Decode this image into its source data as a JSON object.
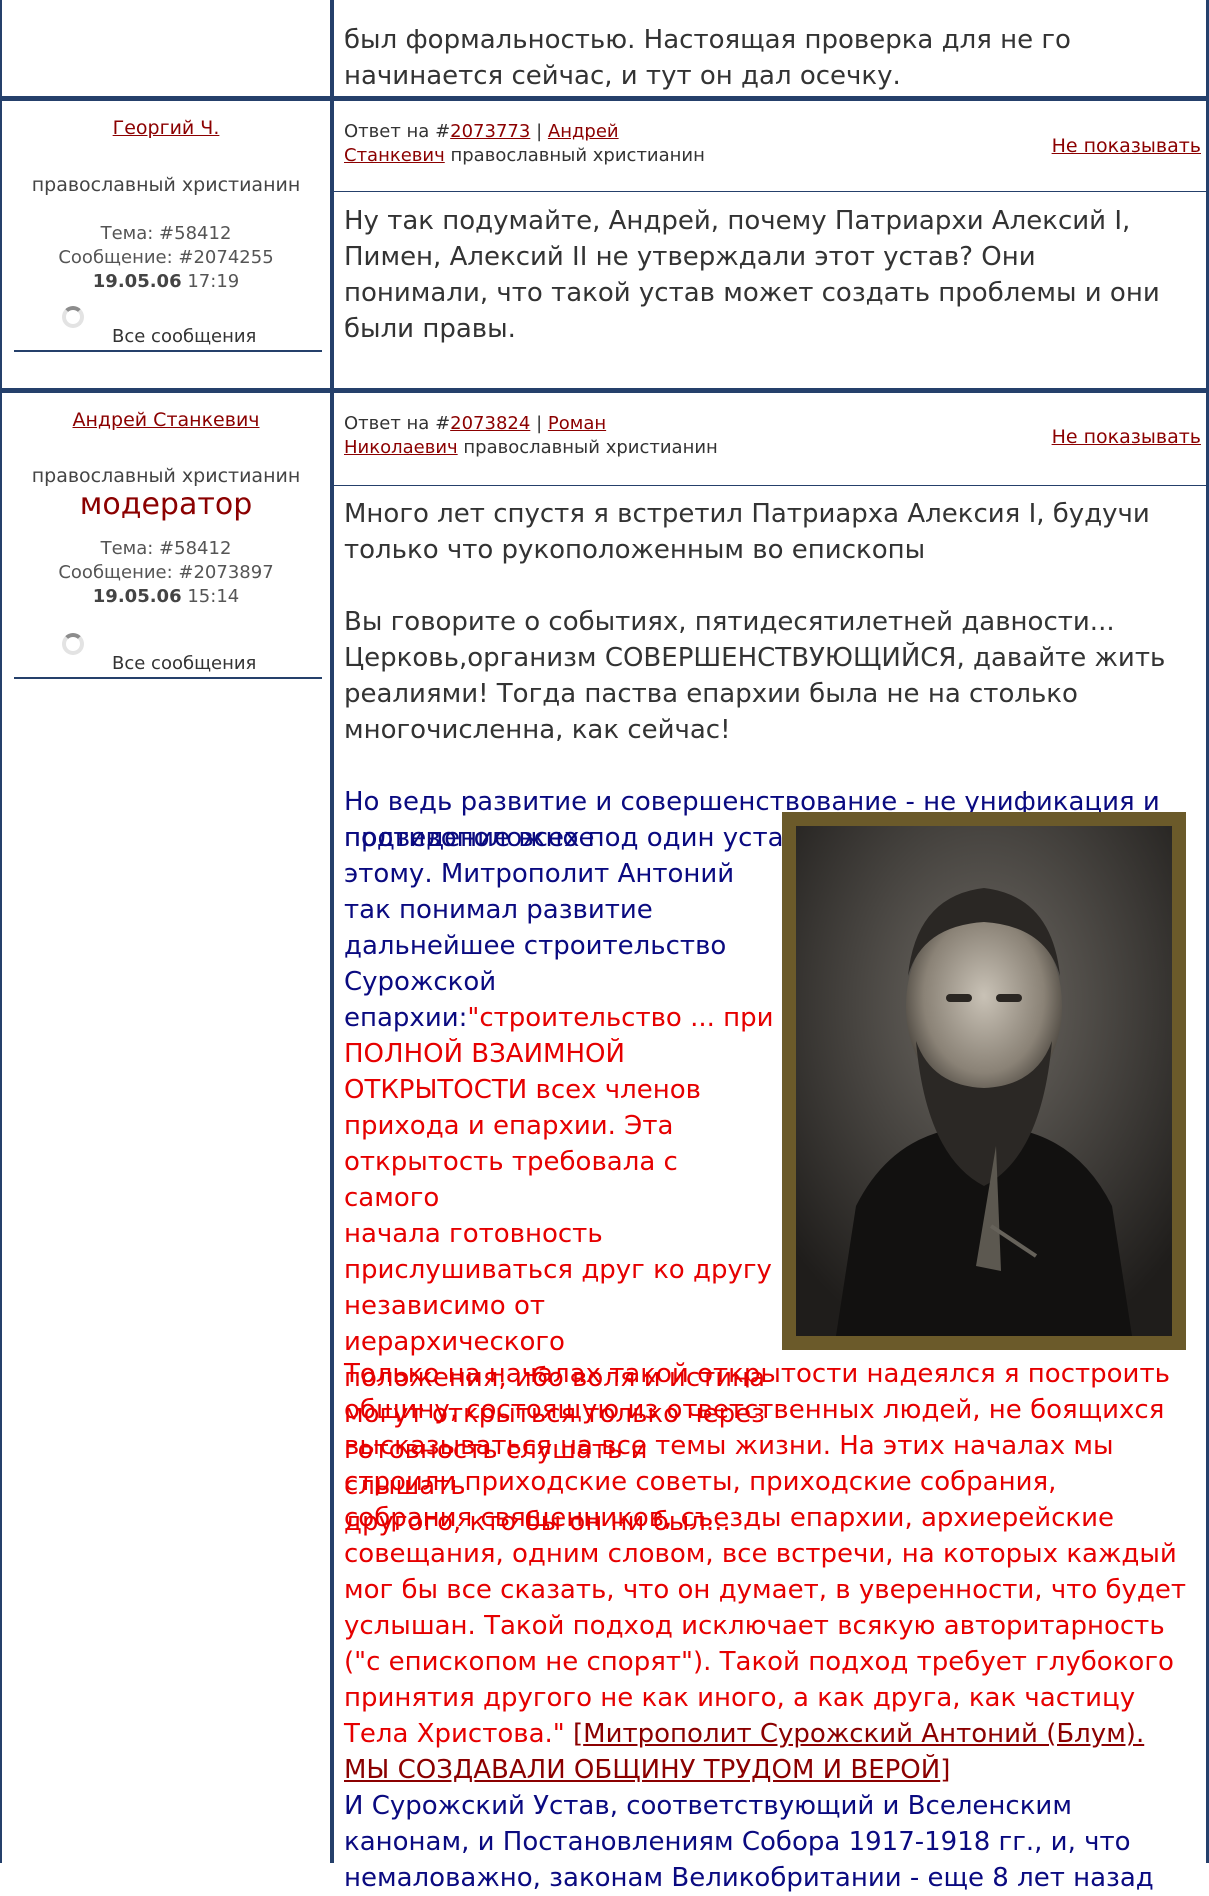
{
  "post0": {
    "text_line1": "был формальностью. Настоящая проверка для не го",
    "text_line2": "начинается сейчас, и тут он дал осечку."
  },
  "post1": {
    "author": "Георгий Ч.",
    "role": "православный христианин",
    "topic": "Тема: #58412",
    "message_id": "Сообщение: #2074255",
    "date": "19.05.06",
    "time": "17:19",
    "all_messages": "Все сообщения",
    "reply_prefix": "Ответ на #",
    "reply_id": "2073773",
    "reply_sep": "|",
    "reply_author_1": "Андрей",
    "reply_author_2": "Станкевич",
    "reply_author_role": "православный христианин",
    "hide": "Не показывать",
    "body": [
      "Ну так подумайте, Андрей, почему Патриархи Алексий I,",
      "Пимен, Алексий II не утверждали этот устав? Они",
      "понимали, что такой устав может создать проблемы и они",
      "были правы."
    ]
  },
  "post2": {
    "author": "Андрей Станкевич",
    "role": "православный христианин",
    "moderator": "модератор",
    "topic": "Тема: #58412",
    "message_id": "Сообщение: #2073897",
    "date": "19.05.06",
    "time": "15:14",
    "all_messages": "Все сообщения",
    "reply_prefix": "Ответ на #",
    "reply_id": "2073824",
    "reply_sep": "|",
    "reply_author_1": "Роман",
    "reply_author_2": "Николаевич",
    "reply_author_role": "православный христианин",
    "hide": "Не показывать",
    "quote_gray": [
      "Много лет спустя я встретил Патриарха Алексия I, будучи",
      "только что рукоположенным во епископы",
      "",
      "Вы говорите о событиях, пятидесятилетней давности...",
      "Церковь,организм СОВЕРШЕНСТВУЮЩИЙСЯ, давайте жить",
      "реалиями! Тогда паства епархии была не на столько",
      "многочисленна, как сейчас!"
    ],
    "blue_full": [
      "Но ведь развитие и совершенствование - не унификация и",
      "подведение всех под один устав - а действие совершенно"
    ],
    "blue_narrow": [
      "противоположное",
      "этому. Митрополит Антоний",
      "так понимал развитие",
      "дальнейшее строительство",
      "Сурожской"
    ],
    "mixed_line_blue": "епархии:",
    "mixed_line_red": "\"строительство ... при",
    "red_narrow": [
      "ПОЛНОЙ ВЗАИМНОЙ",
      "ОТКРЫТОСТИ всех членов",
      "прихода и епархии. Эта",
      "открытость требовала с самого",
      "начала готовность",
      "прислушиваться друг ко другу",
      "независимо от иерархического",
      "положения, ибо воля и истина",
      "могут открыться только через",
      "готовность слушать и слышать",
      "другого, кто бы он ни был..."
    ],
    "red_full": [
      "Только на началах такой открытости надеялся я построить",
      "общину, состоящую из ответственных людей, не боящихся",
      "высказываться на все темы жизни. На этих началах мы",
      "строили приходские советы, приходские собрания,",
      "собрания священников, съезды епархии, архиерейские",
      "совещания, одним словом, все встречи, на которых каждый",
      "мог бы все сказать, что он думает, в уверенности, что будет",
      "услышан. Такой подход исключает всякую авторитарность",
      "(\"с епископом не спорят\"). Такой подход требует глубокого",
      "принятия другого не как иного, а как друга, как частицу"
    ],
    "red_last": "Тела Христова.\"",
    "bracket_open": "[",
    "source_link_1": "Митрополит Сурожский Антоний (Блум).",
    "source_link_2": "МЫ СОЗДАВАЛИ ОБЩИНУ ТРУДОМ И ВЕРОЙ",
    "bracket_close": "]",
    "blue_end": [
      "И Сурожский Устав, соответствующий и Вселенским",
      "канонам, и Постановлениям Собора 1917-1918 гг., и, что",
      "немаловажно, законам Великобритании - еще 8 лет назад"
    ]
  }
}
